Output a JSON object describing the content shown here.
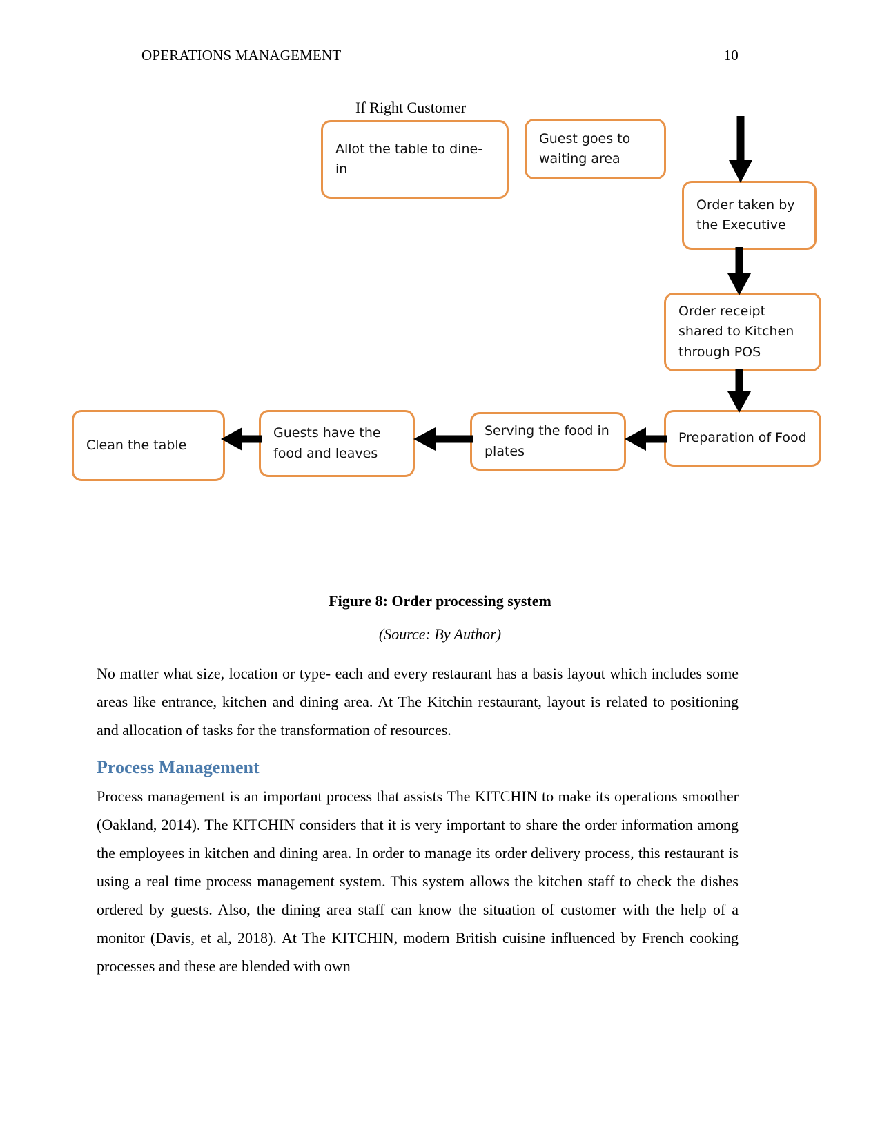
{
  "header": {
    "title": "OPERATIONS MANAGEMENT",
    "page_number": "10"
  },
  "figure": {
    "label_if_right_customer": "If Right Customer",
    "boxes": [
      {
        "id": "allot",
        "text": "Allot the table to dine-in"
      },
      {
        "id": "waiting",
        "text": "Guest goes to waiting area"
      },
      {
        "id": "order_taken",
        "text": "Order taken by the Executive"
      },
      {
        "id": "receipt",
        "text": "Order receipt shared to Kitchen through POS"
      },
      {
        "id": "preparation",
        "text": "Preparation of Food"
      },
      {
        "id": "serving",
        "text": "Serving the food in plates"
      },
      {
        "id": "guests",
        "text": "Guests have the food and leaves"
      },
      {
        "id": "clean",
        "text": "Clean the table"
      }
    ],
    "caption": "Figure 8: Order processing system",
    "source": "(Source: By Author)",
    "box_border_color": "#E89349",
    "arrow_color": "#000000"
  },
  "body": {
    "paragraph_1": "No matter what size, location or type- each and every restaurant has a basis layout which includes some areas like entrance, kitchen and dining area. At The Kitchin restaurant, layout is related to positioning and allocation of tasks for the transformation of resources.",
    "heading_process_management": "Process Management",
    "heading_color": "#4A7AAB",
    "paragraph_2": "Process management is an important process that assists The KITCHIN to make its operations smoother (Oakland, 2014). The KITCHIN considers that it is very important to share the order information among the employees in kitchen and dining area. In order to manage its order delivery process, this restaurant is using a real time process management system. This system allows the kitchen staff to check the dishes ordered by guests. Also, the dining area staff can know the situation of customer with the help of a monitor (Davis, et al, 2018). At The KITCHIN, modern British cuisine influenced by French cooking processes and these are blended with own"
  }
}
